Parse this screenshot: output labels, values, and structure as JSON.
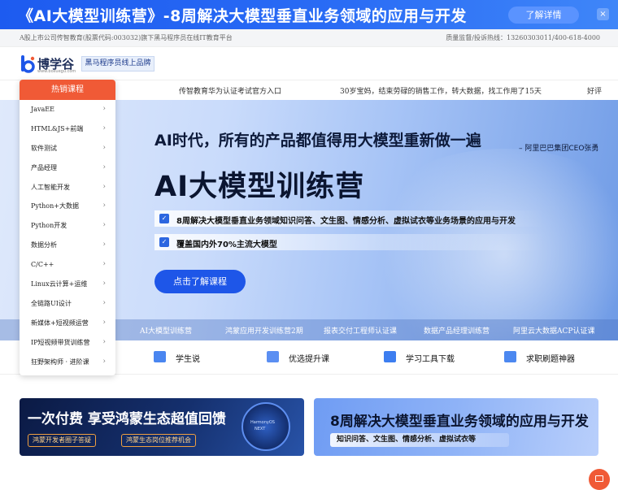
{
  "promo": {
    "title": "《AI大模型训练营》-8周解决大模型垂直业务领域的应用与开发",
    "button": "了解详情",
    "close": "×"
  },
  "strip": {
    "left": "A股上市公司传智教育(股票代码:003032)旗下黑马程序员在线IT教育平台",
    "right": "质量监督/投诉热线：13260303011/400-618-4000"
  },
  "header": {
    "logo_name": "博学谷",
    "logo_url": "www.boxuegu.com",
    "tag": "黑马程序员线上品牌"
  },
  "nav": {
    "items": [
      "传智教育华为认证考试官方入口",
      "30岁宝妈，结束劳碌的销售工作，转大数据，找工作用了15天",
      "好评"
    ]
  },
  "sidebar": {
    "header": "热销课程",
    "items": [
      "JavaEE",
      "HTML&JS+前端",
      "软件测试",
      "产品经理",
      "人工智能开发",
      "Python+大数据",
      "Python开发",
      "数据分析",
      "C/C++",
      "Linux云计算+运维",
      "全链路UI设计",
      "新媒体+短视频运营",
      "IP短视频带货训练营",
      "狂野架构师 · 进阶课"
    ]
  },
  "hero": {
    "quote": "AI时代，所有的产品都值得用大模型重新做一遍",
    "author": "– 阿里巴巴集团CEO张勇",
    "title": "AI大模型训练营",
    "bullets": [
      "8周解决大模型垂直业务领域知识问答、文生图、情感分析、虚拟试衣等业务场景的应用与开发",
      "覆盖国内外70%主流大模型"
    ],
    "cta": "点击了解课程",
    "tabs": [
      "AI大模型训练营",
      "鸿蒙应用开发训练营2期",
      "报表交付工程师认证课",
      "数据产品经理训练营",
      "阿里云大数据ACP认证课"
    ]
  },
  "quick": {
    "items": [
      {
        "label": "学生说",
        "icon": "chat-icon"
      },
      {
        "label": "优选提升课",
        "icon": "monitor-icon"
      },
      {
        "label": "学习工具下载",
        "icon": "download-icon"
      },
      {
        "label": "求职刷题神器",
        "icon": "document-icon"
      }
    ]
  },
  "banner_left": {
    "title": "一次付费 享受鸿蒙生态超值回馈",
    "pill1": "鸿蒙开发者圈子答疑",
    "pill2": "鸿蒙生态岗位推荐机会",
    "disk_text1": "HarmonyOS",
    "disk_text2": "NEXT"
  },
  "banner_right": {
    "title": "8周解决大模型垂直业务领域的应用与开发",
    "subtitle": "知识问答、文生图、情感分析、虚拟试衣等"
  },
  "colors": {
    "primary": "#1e56e8",
    "accent_orange": "#f05a36"
  }
}
